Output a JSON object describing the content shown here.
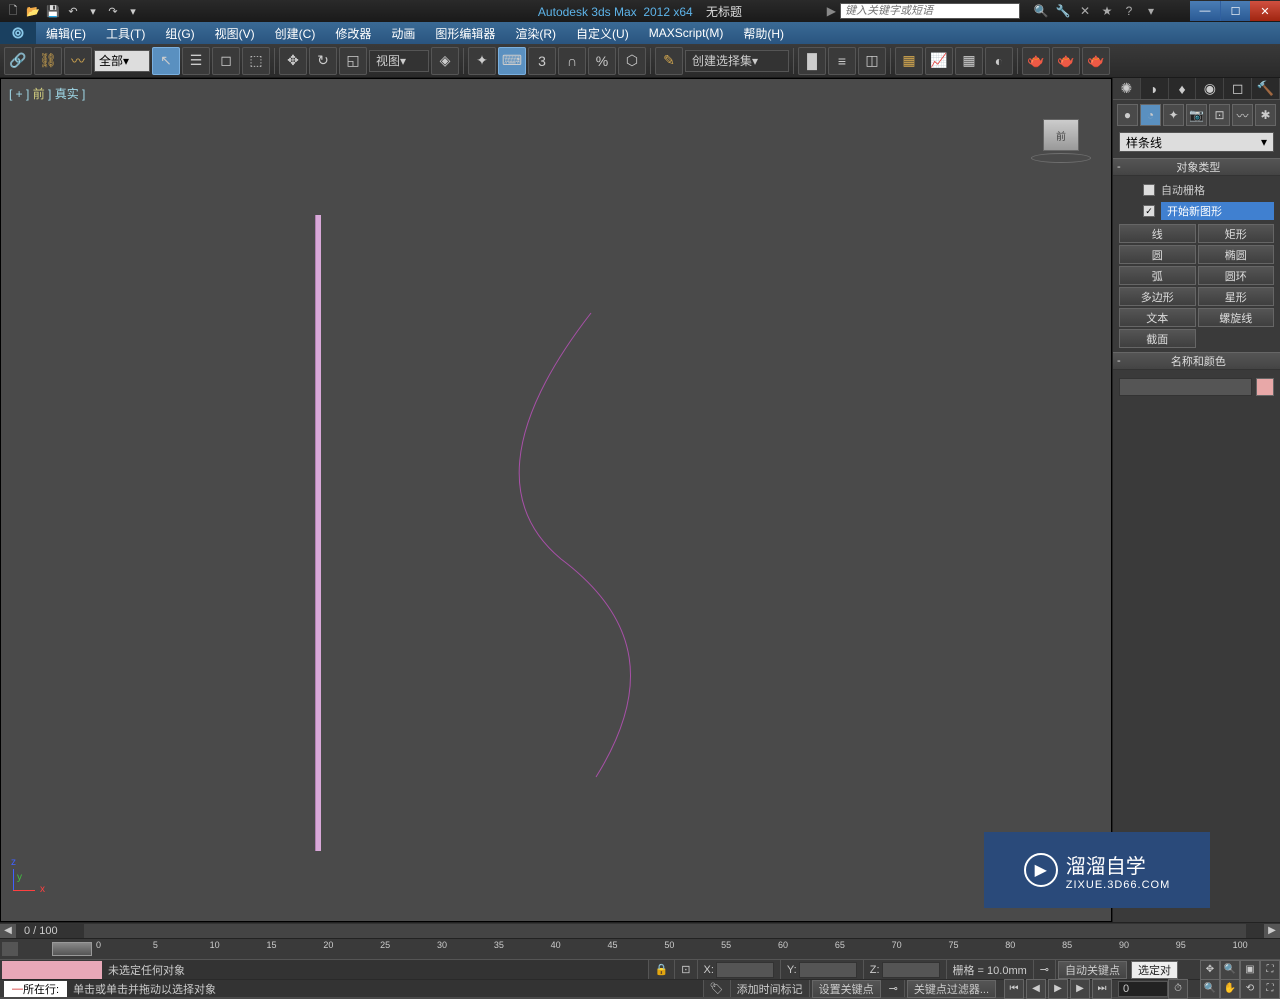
{
  "titlebar": {
    "appName": "Autodesk 3ds Max",
    "version": "2012 x64",
    "docTitle": "无标题",
    "searchPlaceholder": "键入关键字或短语"
  },
  "menubar": {
    "items": [
      "编辑(E)",
      "工具(T)",
      "组(G)",
      "视图(V)",
      "创建(C)",
      "修改器",
      "动画",
      "图形编辑器",
      "渲染(R)",
      "自定义(U)",
      "MAXScript(M)",
      "帮助(H)"
    ]
  },
  "toolbar": {
    "filterAll": "全部",
    "viewDropdown": "视图",
    "namedSelection": "创建选择集",
    "snapLabel": "3"
  },
  "viewport": {
    "label": "[ + ] 前 ] 真实  ]",
    "cubeFace": "前"
  },
  "commandPanel": {
    "shapeDropdown": "样条线",
    "rollouts": {
      "objectType": {
        "title": "对象类型",
        "autoGrid": "自动栅格",
        "startNewShape": "开始新图形",
        "buttons": [
          "线",
          "矩形",
          "圆",
          "椭圆",
          "弧",
          "圆环",
          "多边形",
          "星形",
          "文本",
          "螺旋线",
          "截面"
        ]
      },
      "nameColor": {
        "title": "名称和颜色"
      }
    }
  },
  "timeline": {
    "frameDisplay": "0 / 100",
    "ticks": [
      "0",
      "5",
      "10",
      "15",
      "20",
      "25",
      "30",
      "35",
      "40",
      "45",
      "50",
      "55",
      "60",
      "65",
      "70",
      "75",
      "80",
      "85",
      "90",
      "95",
      "100"
    ]
  },
  "statusbar": {
    "selection": "未选定任何对象",
    "prompt": "单击或单击并拖动以选择对象",
    "gridLabel": "栅格 = 10.0mm",
    "autoKey": "自动关键点",
    "setKey": "设置关键点",
    "selectedObj": "选定对",
    "keyFilters": "关键点过滤器...",
    "addTimeTag": "添加时间标记",
    "xLabel": "X:",
    "yLabel": "Y:",
    "zLabel": "Z:",
    "currentFrame": "0",
    "scriptListener": "所在行:"
  },
  "watermark": {
    "brand": "溜溜自学",
    "url": "ZIXUE.3D66.COM"
  }
}
